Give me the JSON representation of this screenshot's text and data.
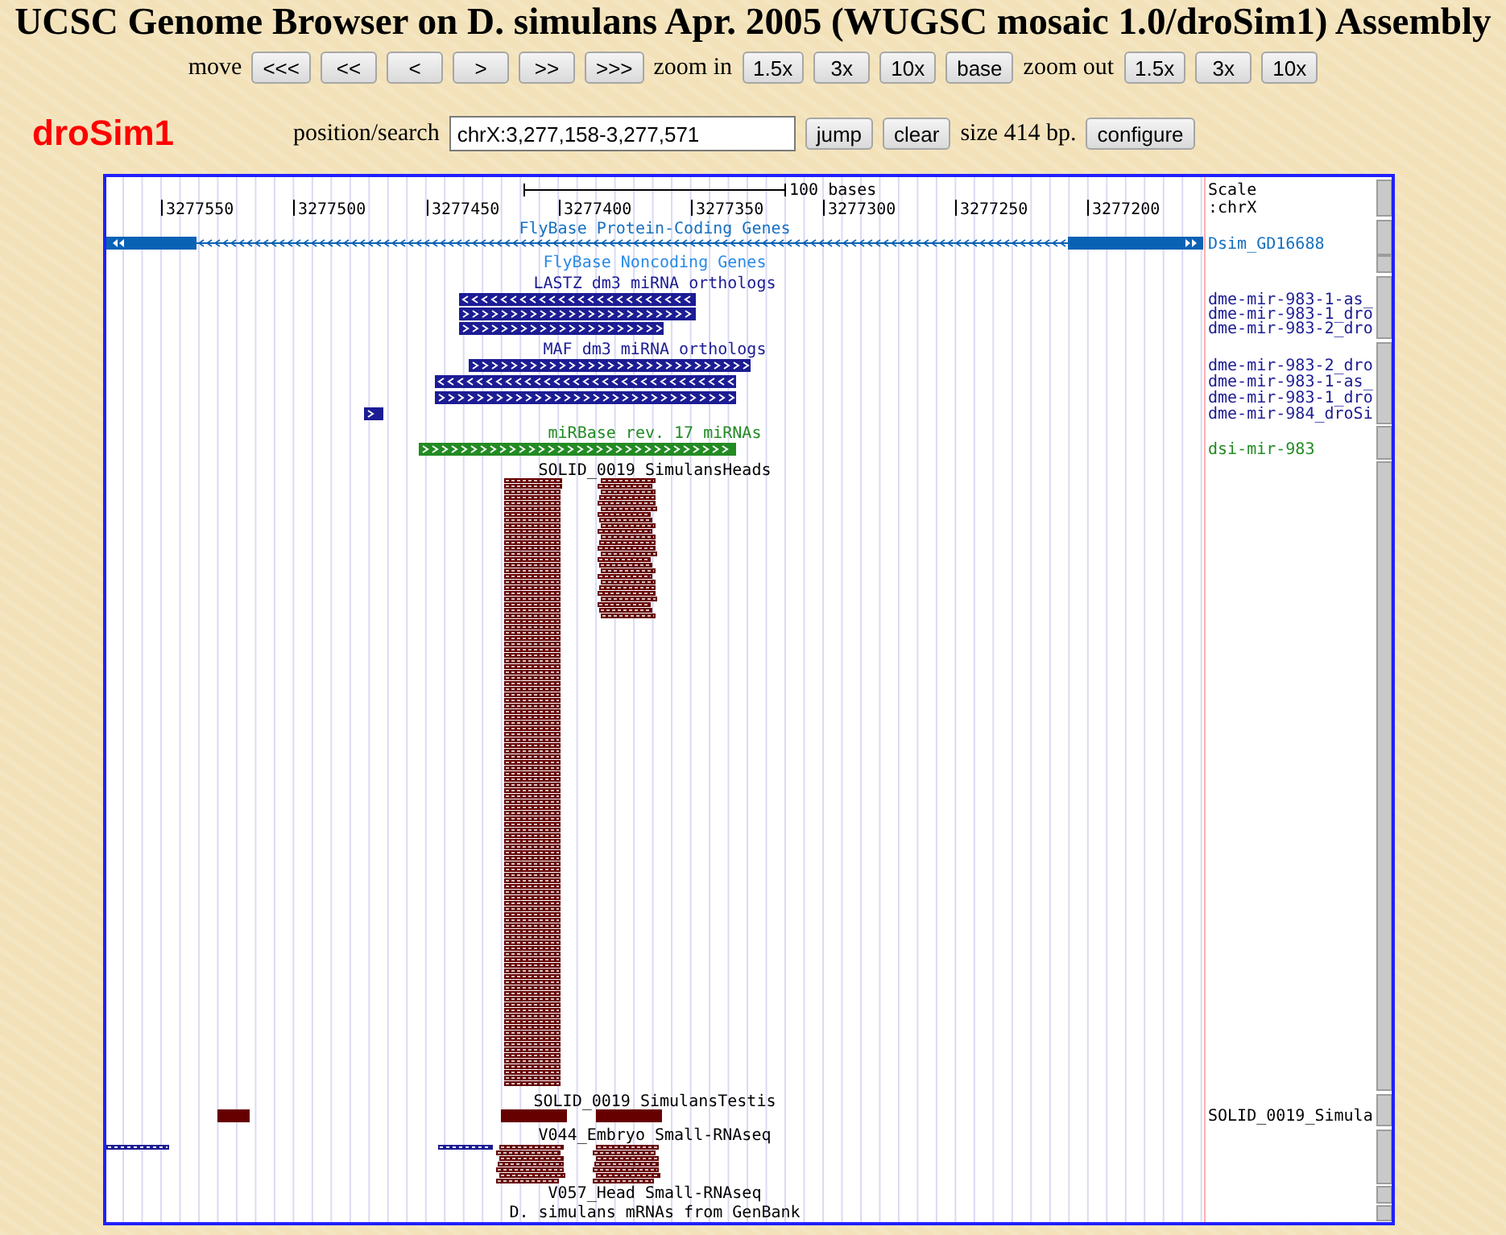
{
  "window": {
    "title": "UCSC Genome Browser on D. simulans Apr. 2005 (WUGSC mosaic 1.0/droSim1) Assembly"
  },
  "navigation": {
    "move": {
      "label": "move",
      "buttons": [
        "<<<",
        "<<",
        "<",
        ">",
        ">>",
        ">>>"
      ]
    },
    "zoom_in": {
      "label": "zoom in",
      "buttons": [
        "1.5x",
        "3x",
        "10x",
        "base"
      ]
    },
    "zoom_out": {
      "label": "zoom out",
      "buttons": [
        "1.5x",
        "3x",
        "10x"
      ]
    }
  },
  "database": "droSim1",
  "position_search": {
    "label": "position/search",
    "value": "chrX:3,277,158-3,277,571",
    "buttons": [
      "jump",
      "clear"
    ],
    "size": "size 414 bp.",
    "configure_button": "configure"
  },
  "track_image": {
    "scale_bar": "100 bases",
    "ruler_ticks": [
      "3277550",
      "3277500",
      "3277450",
      "3277400",
      "3277350",
      "3277300",
      "3277250",
      "3277200"
    ],
    "scale_labels": [
      "Scale",
      ":chrX"
    ],
    "tracks": [
      {
        "title": "FlyBase Protein-Coding Genes",
        "color": "#1670c0",
        "labels": [
          "Dsim_GD16688"
        ],
        "features": [
          {
            "kind": "gene",
            "reverse_strand": true,
            "color": "#0a62b4"
          }
        ]
      },
      {
        "title": "FlyBase Noncoding Genes",
        "color": "#2a8ae6"
      },
      {
        "title": "LASTZ dm3 miRNA orthologs",
        "color": "#1c1c94",
        "labels": [
          "dme-mir-983-1-as_",
          "dme-mir-983-1_dro",
          "dme-mir-983-2_dro"
        ],
        "features": [
          {
            "kind": "bar",
            "reverse_strand": true,
            "color": "#1c1c94"
          },
          {
            "kind": "bar",
            "reverse_strand": false,
            "color": "#1c1c94"
          },
          {
            "kind": "bar",
            "reverse_strand": false,
            "color": "#1c1c94"
          }
        ]
      },
      {
        "title": "MAF dm3 miRNA orthologs",
        "color": "#1c1c94",
        "labels": [
          "dme-mir-983-2_dro",
          "dme-mir-983-1-as_",
          "dme-mir-983-1_dro",
          "dme-mir-984_droSi"
        ],
        "features": [
          {
            "kind": "bar",
            "reverse_strand": false,
            "color": "#1c1c94"
          },
          {
            "kind": "bar",
            "reverse_strand": true,
            "color": "#1c1c94"
          },
          {
            "kind": "bar",
            "reverse_strand": false,
            "color": "#1c1c94"
          },
          {
            "kind": "bar",
            "reverse_strand": false,
            "color": "#1c1c94"
          }
        ]
      },
      {
        "title": "miRBase rev. 17 miRNAs",
        "color": "#238b23",
        "labels": [
          "dsi-mir-983"
        ],
        "features": [
          {
            "kind": "bar",
            "reverse_strand": false,
            "color": "#238b23"
          }
        ]
      },
      {
        "title": "SOLID_0019_SimulansHeads",
        "features": [
          {
            "kind": "pileup",
            "color": "#660000"
          },
          {
            "kind": "pileup",
            "color": "#660000"
          }
        ]
      },
      {
        "title": "SOLID_0019_SimulansTestis",
        "labels": [
          "SOLID_0019_Simula"
        ],
        "features": [
          {
            "kind": "block",
            "color": "#660000"
          },
          {
            "kind": "block",
            "color": "#660000"
          },
          {
            "kind": "block",
            "color": "#660000"
          }
        ]
      },
      {
        "title": "V044_Embryo Small-RNAseq",
        "features": [
          {
            "kind": "dashed",
            "color": "#1c1c94"
          },
          {
            "kind": "dashed",
            "color": "#1c1c94"
          },
          {
            "kind": "pileup",
            "color": "#660000"
          },
          {
            "kind": "pileup",
            "color": "#660000"
          }
        ]
      },
      {
        "title": "V057_Head Small-RNAseq"
      },
      {
        "title": "D. simulans mRNAs from GenBank"
      }
    ]
  }
}
